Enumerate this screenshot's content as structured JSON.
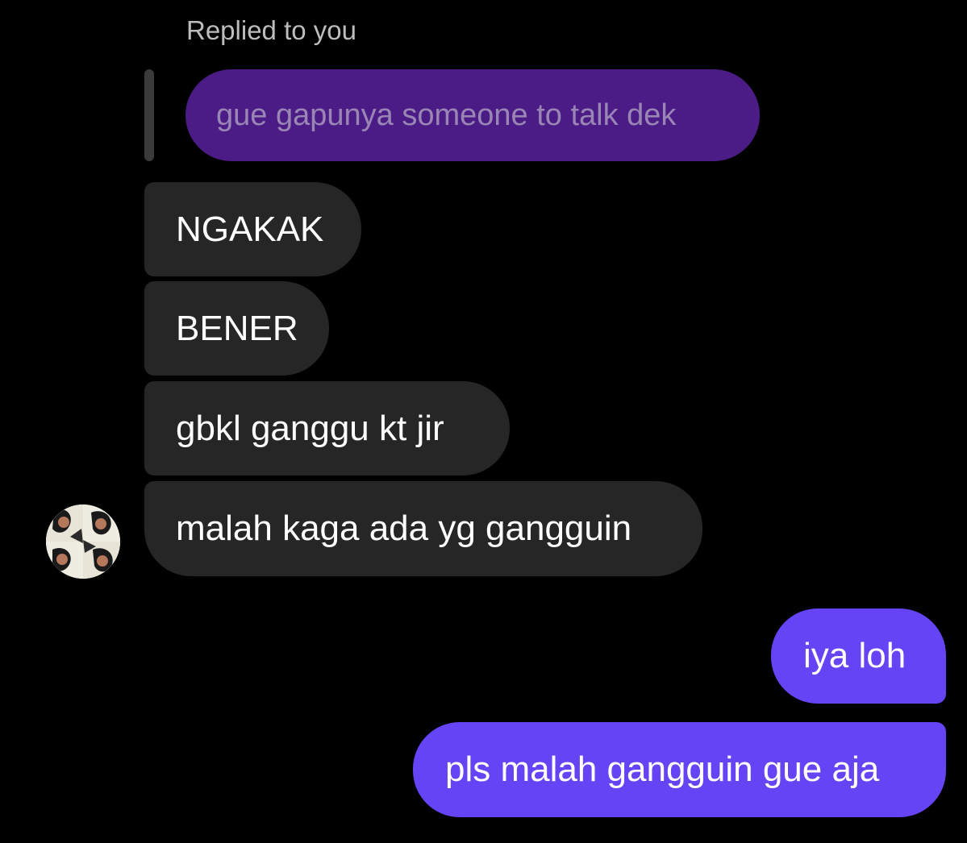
{
  "reply": {
    "label": "Replied to you",
    "quoted_text": "gue gapunya someone to talk dek"
  },
  "incoming_messages": [
    {
      "text": "NGAKAK"
    },
    {
      "text": "BENER"
    },
    {
      "text": "gbkl ganggu kt jir"
    },
    {
      "text": "malah kaga ada yg gangguin"
    }
  ],
  "outgoing_messages": [
    {
      "text": "iya loh"
    },
    {
      "text": "pls malah gangguin gue aja"
    }
  ],
  "colors": {
    "background": "#000000",
    "incoming_bubble": "#262626",
    "outgoing_bubble": "#6544f5",
    "quoted_bubble": "#4b1b86",
    "quoted_text": "#9a86b4"
  },
  "icons": {
    "avatar": "sender-avatar"
  }
}
